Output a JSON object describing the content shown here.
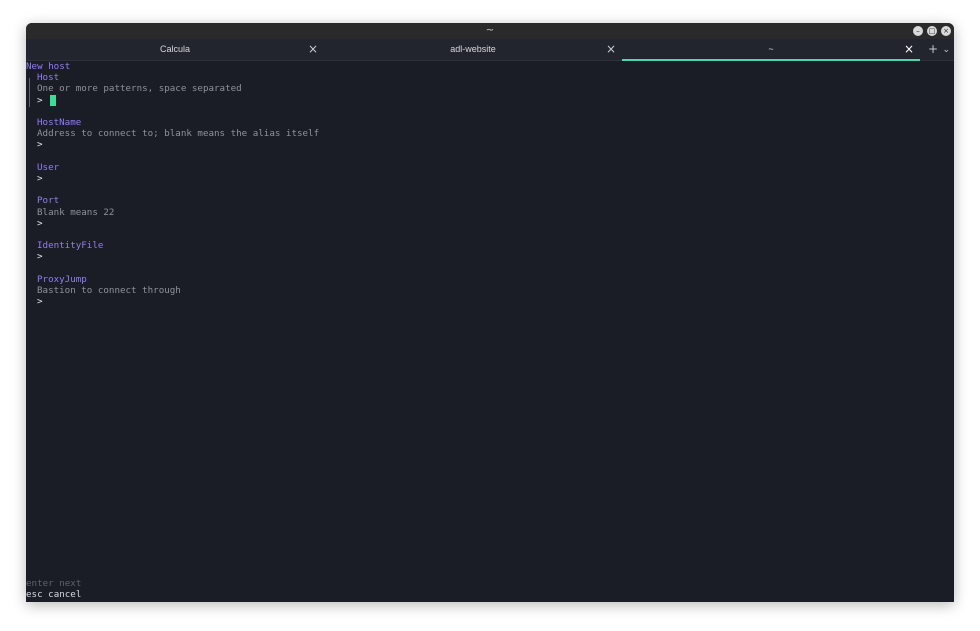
{
  "window": {
    "title": "~",
    "buttons": {
      "minimize": "–",
      "maximize": "□",
      "close": "×"
    }
  },
  "tabs": [
    {
      "label": "Calcula",
      "active": false
    },
    {
      "label": "adl-website",
      "active": false
    },
    {
      "label": "~",
      "active": true
    }
  ],
  "tab_controls": {
    "close_glyph": "×",
    "new_tab": "+",
    "menu": "⌄"
  },
  "form": {
    "title": "New host",
    "prompt_char": ">",
    "fields": [
      {
        "label": "Host",
        "description": "One or more patterns, space separated",
        "value": "",
        "focused": true
      },
      {
        "label": "HostName",
        "description": "Address to connect to; blank means the alias itself",
        "value": ""
      },
      {
        "label": "User",
        "description": "",
        "value": ""
      },
      {
        "label": "Port",
        "description": "Blank means 22",
        "value": ""
      },
      {
        "label": "IdentityFile",
        "description": "",
        "value": ""
      },
      {
        "label": "ProxyJump",
        "description": "Bastion to connect through",
        "value": ""
      }
    ]
  },
  "help": {
    "enter_key": "enter",
    "enter_action": "next",
    "esc_key": "esc",
    "esc_action": "cancel"
  },
  "colors": {
    "accent_purple": "#8f7ff2",
    "cursor_green": "#3ddc97",
    "tab_underline": "#4dd6b0",
    "terminal_bg": "#1b1d26"
  }
}
